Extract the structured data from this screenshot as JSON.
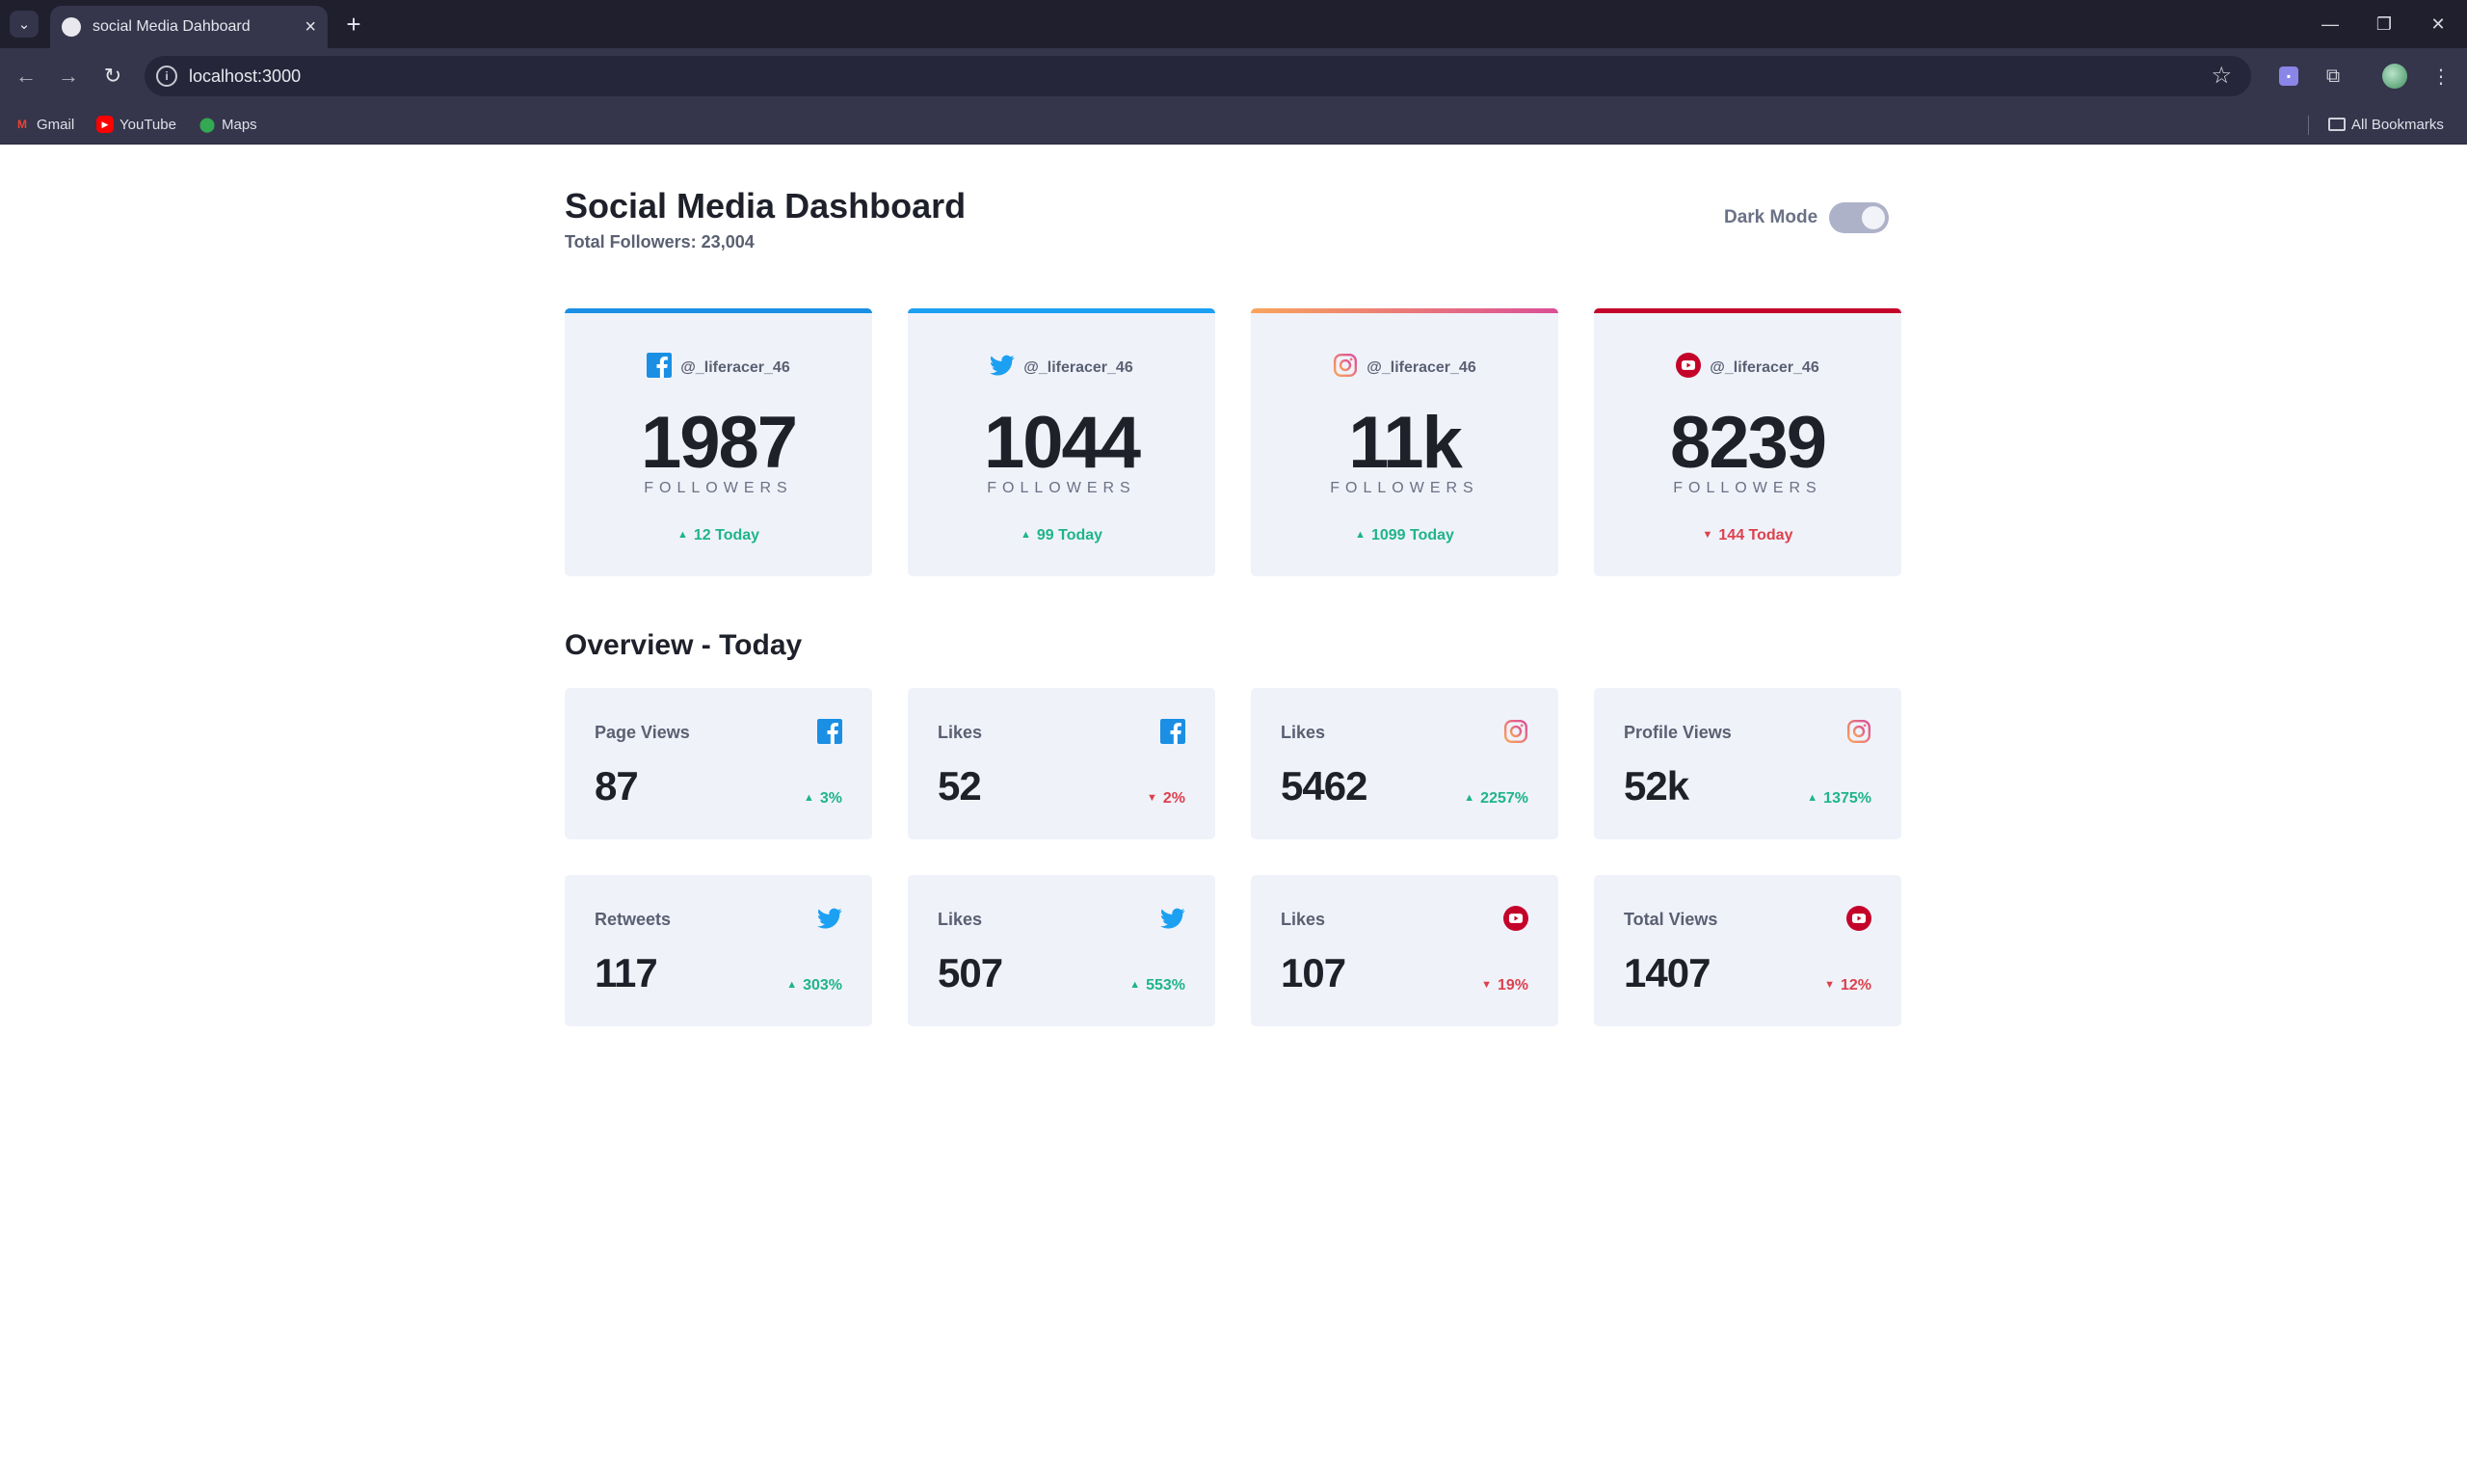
{
  "browser": {
    "tab_title": "social Media Dahboard",
    "url": "localhost:3000",
    "bookmarks": [
      "Gmail",
      "YouTube",
      "Maps"
    ],
    "all_bookmarks": "All Bookmarks"
  },
  "header": {
    "title": "Social Media Dashboard",
    "total_followers": "Total Followers: 23,004",
    "dark_mode_label": "Dark Mode",
    "dark_mode_on": true
  },
  "colors": {
    "facebook": "#1a8fe4",
    "twitter": "#1ca0f2",
    "instagram_start": "#f9a45b",
    "instagram_end": "#da4e97",
    "youtube": "#c4032a",
    "up": "#1eb589",
    "down": "#dc414c"
  },
  "cards": [
    {
      "platform": "facebook",
      "icon": "facebook-icon",
      "handle": "@_liferacer_46",
      "count": "1987",
      "label": "FOLLOWERS",
      "change": "12 Today",
      "trend": "up"
    },
    {
      "platform": "twitter",
      "icon": "twitter-icon",
      "handle": "@_liferacer_46",
      "count": "1044",
      "label": "FOLLOWERS",
      "change": "99 Today",
      "trend": "up"
    },
    {
      "platform": "instagram",
      "icon": "instagram-icon",
      "handle": "@_liferacer_46",
      "count": "11k",
      "label": "FOLLOWERS",
      "change": "1099 Today",
      "trend": "up"
    },
    {
      "platform": "youtube",
      "icon": "youtube-icon",
      "handle": "@_liferacer_46",
      "count": "8239",
      "label": "FOLLOWERS",
      "change": "144 Today",
      "trend": "down"
    }
  ],
  "overview": {
    "title": "Overview - Today",
    "items": [
      {
        "label": "Page Views",
        "platform": "facebook",
        "value": "87",
        "change": "3%",
        "trend": "up"
      },
      {
        "label": "Likes",
        "platform": "facebook",
        "value": "52",
        "change": "2%",
        "trend": "down"
      },
      {
        "label": "Likes",
        "platform": "instagram",
        "value": "5462",
        "change": "2257%",
        "trend": "up"
      },
      {
        "label": "Profile Views",
        "platform": "instagram",
        "value": "52k",
        "change": "1375%",
        "trend": "up"
      },
      {
        "label": "Retweets",
        "platform": "twitter",
        "value": "117",
        "change": "303%",
        "trend": "up"
      },
      {
        "label": "Likes",
        "platform": "twitter",
        "value": "507",
        "change": "553%",
        "trend": "up"
      },
      {
        "label": "Likes",
        "platform": "youtube",
        "value": "107",
        "change": "19%",
        "trend": "down"
      },
      {
        "label": "Total Views",
        "platform": "youtube",
        "value": "1407",
        "change": "12%",
        "trend": "down"
      }
    ]
  }
}
